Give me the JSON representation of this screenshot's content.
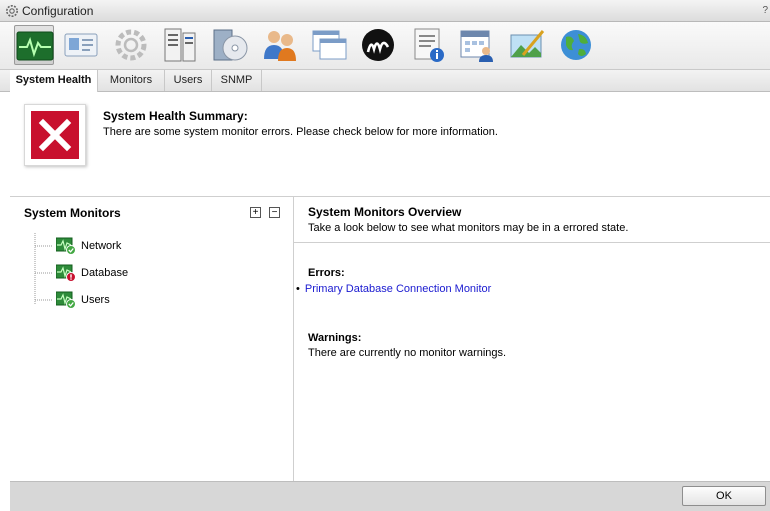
{
  "window": {
    "title": "Configuration",
    "help_glyph": "?"
  },
  "toolbar": {
    "items": [
      {
        "id": "system-health",
        "icon": "heartbeat-monitor-icon",
        "active": true
      },
      {
        "id": "id-card",
        "icon": "id-card-icon"
      },
      {
        "id": "settings",
        "icon": "gear-icon"
      },
      {
        "id": "server",
        "icon": "server-icon"
      },
      {
        "id": "backup",
        "icon": "disc-backup-icon"
      },
      {
        "id": "users",
        "icon": "users-icon"
      },
      {
        "id": "windows",
        "icon": "windows-icon"
      },
      {
        "id": "brand",
        "icon": "m-logo-icon"
      },
      {
        "id": "document-info",
        "icon": "document-info-icon"
      },
      {
        "id": "calendar-user",
        "icon": "calendar-user-icon"
      },
      {
        "id": "image-edit",
        "icon": "image-edit-icon"
      },
      {
        "id": "globe",
        "icon": "globe-icon"
      }
    ]
  },
  "tabs": [
    {
      "label": "System Health",
      "active": true
    },
    {
      "label": "Monitors"
    },
    {
      "label": "Users"
    },
    {
      "label": "SNMP"
    }
  ],
  "summary": {
    "title": "System Health Summary:",
    "message": "There are some system monitor errors. Please check below for more information.",
    "status_icon": "error-x-icon"
  },
  "monitors_panel": {
    "title": "System Monitors",
    "expand_glyph": "+",
    "collapse_glyph": "−",
    "items": [
      {
        "label": "Network",
        "status": "ok"
      },
      {
        "label": "Database",
        "status": "error"
      },
      {
        "label": "Users",
        "status": "ok"
      }
    ]
  },
  "overview": {
    "title": "System Monitors Overview",
    "subtitle": "Take a look below to see what monitors may be in a errored state.",
    "errors_heading": "Errors:",
    "errors": [
      "Primary Database Connection Monitor"
    ],
    "bullet": "•",
    "warnings_heading": "Warnings:",
    "warnings_text": "There are currently no monitor warnings."
  },
  "footer": {
    "ok_label": "OK"
  },
  "colors": {
    "error_red": "#c8102e",
    "ok_green": "#43a843",
    "link_blue": "#1a1ad0",
    "monitor_green": "#2e8b3a"
  }
}
